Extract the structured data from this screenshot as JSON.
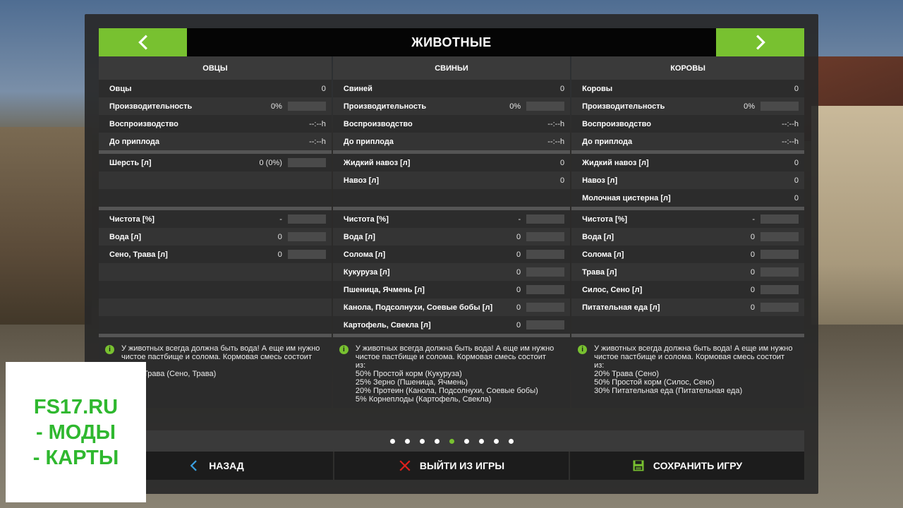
{
  "title": "ЖИВОТНЫЕ",
  "columns": [
    {
      "header": "ОВЦЫ",
      "stats": [
        {
          "label": "Овцы",
          "value": "0",
          "bar": false
        },
        {
          "label": "Производительность",
          "value": "0%",
          "bar": true
        },
        {
          "label": "Воспроизводство",
          "value": "--:--h",
          "bar": false
        },
        {
          "label": "До приплода",
          "value": "--:--h",
          "bar": false
        }
      ],
      "products": [
        {
          "label": "Шерсть [л]",
          "value": "0 (0%)",
          "bar": true
        },
        {
          "label": "",
          "value": "",
          "bar": false
        },
        {
          "label": "",
          "value": "",
          "bar": false
        }
      ],
      "needs": [
        {
          "label": "Чистота [%]",
          "value": "-",
          "bar": true
        },
        {
          "label": "Вода [л]",
          "value": "0",
          "bar": true
        },
        {
          "label": "Сено, Трава [л]",
          "value": "0",
          "bar": true
        },
        {
          "label": "",
          "value": "",
          "bar": false
        },
        {
          "label": "",
          "value": "",
          "bar": false
        },
        {
          "label": "",
          "value": "",
          "bar": false
        },
        {
          "label": "",
          "value": "",
          "bar": false
        }
      ],
      "info": "У животных всегда должна быть вода! А еще им нужно\nчистое пастбище и солома. Кормовая смесь состоит\nиз:\n100% Трава (Сено, Трава)"
    },
    {
      "header": "СВИНЬИ",
      "stats": [
        {
          "label": "Свиней",
          "value": "0",
          "bar": false
        },
        {
          "label": "Производительность",
          "value": "0%",
          "bar": true
        },
        {
          "label": "Воспроизводство",
          "value": "--:--h",
          "bar": false
        },
        {
          "label": "До приплода",
          "value": "--:--h",
          "bar": false
        }
      ],
      "products": [
        {
          "label": "Жидкий навоз [л]",
          "value": "0",
          "bar": false
        },
        {
          "label": "Навоз [л]",
          "value": "0",
          "bar": false
        },
        {
          "label": "",
          "value": "",
          "bar": false
        }
      ],
      "needs": [
        {
          "label": "Чистота [%]",
          "value": "-",
          "bar": true
        },
        {
          "label": "Вода [л]",
          "value": "0",
          "bar": true
        },
        {
          "label": "Солома [л]",
          "value": "0",
          "bar": true
        },
        {
          "label": "Кукуруза [л]",
          "value": "0",
          "bar": true
        },
        {
          "label": "Пшеница, Ячмень [л]",
          "value": "0",
          "bar": true
        },
        {
          "label": "Канола, Подсолнухи, Соевые бобы [л]",
          "value": "0",
          "bar": true
        },
        {
          "label": "Картофель, Свекла [л]",
          "value": "0",
          "bar": true
        }
      ],
      "info": "У животных всегда должна быть вода! А еще им нужно\nчистое пастбище и солома. Кормовая смесь состоит\nиз:\n50% Простой корм (Кукуруза)\n25% Зерно (Пшеница, Ячмень)\n20% Протеин (Канола, Подсолнухи, Соевые бобы)\n5% Корнеплоды (Картофель, Свекла)"
    },
    {
      "header": "КОРОВЫ",
      "stats": [
        {
          "label": "Коровы",
          "value": "0",
          "bar": false
        },
        {
          "label": "Производительность",
          "value": "0%",
          "bar": true
        },
        {
          "label": "Воспроизводство",
          "value": "--:--h",
          "bar": false
        },
        {
          "label": "До приплода",
          "value": "--:--h",
          "bar": false
        }
      ],
      "products": [
        {
          "label": "Жидкий навоз [л]",
          "value": "0",
          "bar": false
        },
        {
          "label": "Навоз [л]",
          "value": "0",
          "bar": false
        },
        {
          "label": "Молочная цистерна [л]",
          "value": "0",
          "bar": false
        }
      ],
      "needs": [
        {
          "label": "Чистота [%]",
          "value": "-",
          "bar": true
        },
        {
          "label": "Вода [л]",
          "value": "0",
          "bar": true
        },
        {
          "label": "Солома [л]",
          "value": "0",
          "bar": true
        },
        {
          "label": "Трава [л]",
          "value": "0",
          "bar": true
        },
        {
          "label": "Силос, Сено [л]",
          "value": "0",
          "bar": true
        },
        {
          "label": "Питательная еда [л]",
          "value": "0",
          "bar": true
        },
        {
          "label": "",
          "value": "",
          "bar": false
        }
      ],
      "info": "У животных всегда должна быть вода! А еще им нужно\nчистое пастбище и солома. Кормовая смесь состоит\nиз:\n20% Трава (Сено)\n50% Простой корм (Силос, Сено)\n30% Питательная еда (Питательная еда)"
    }
  ],
  "pagination": {
    "count": 9,
    "active_page": 5
  },
  "buttons": {
    "back": "НАЗАД",
    "quit": "ВЫЙТИ ИЗ ИГРЫ",
    "save": "СОХРАНИТЬ ИГРУ"
  },
  "watermark": [
    "FS17.RU",
    "- МОДЫ",
    "- КАРТЫ"
  ],
  "colors": {
    "accent": "#78c130",
    "quit_icon": "#e0201b",
    "back_icon": "#3a9fe0",
    "watermark_text": "#2fb82f"
  },
  "icons": {
    "prev": "chevron-left-icon",
    "next": "chevron-right-icon",
    "info": "info-icon",
    "back": "chevron-left-icon",
    "quit": "close-icon",
    "save": "floppy-disk-icon"
  }
}
